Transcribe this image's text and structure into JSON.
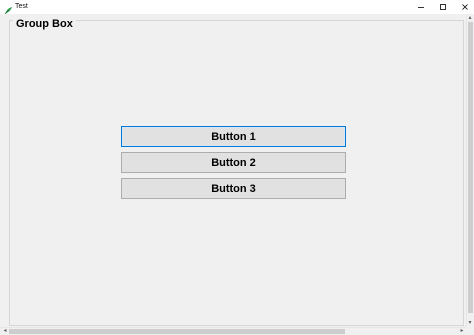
{
  "window": {
    "title": "Test",
    "app_icon": "feather-icon",
    "controls": {
      "minimize_icon": "minimize-icon",
      "maximize_icon": "maximize-icon",
      "close_icon": "close-icon"
    }
  },
  "group_box": {
    "title": "Group Box"
  },
  "buttons": [
    {
      "label": "Button 1",
      "focused": true
    },
    {
      "label": "Button 2",
      "focused": false
    },
    {
      "label": "Button 3",
      "focused": false
    }
  ],
  "scrollbars": {
    "up_arrow": "▴",
    "down_arrow": "▾",
    "left_arrow": "◂",
    "right_arrow": "▸"
  },
  "colors": {
    "client_background": "#f0f0f0",
    "button_face": "#e1e1e1",
    "focus_border": "#0078d7",
    "app_icon": "#2e9e4f"
  }
}
